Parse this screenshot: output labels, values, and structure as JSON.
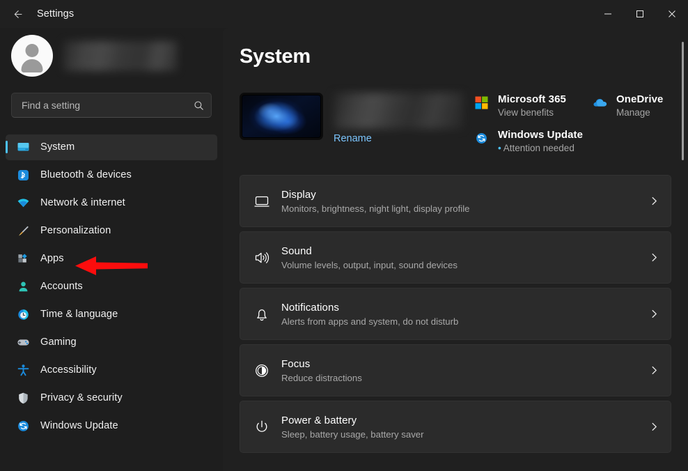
{
  "titlebar": {
    "back_label": "back-arrow",
    "title": "Settings",
    "minimize": "—",
    "maximize": "□",
    "close": "✕"
  },
  "sidebar": {
    "profile": {
      "account_name": ""
    },
    "search": {
      "placeholder": "Find a setting",
      "value": ""
    },
    "items": [
      {
        "label": "System",
        "icon": "monitor-icon",
        "selected": true
      },
      {
        "label": "Bluetooth & devices",
        "icon": "bluetooth-icon",
        "selected": false
      },
      {
        "label": "Network & internet",
        "icon": "wifi-icon",
        "selected": false
      },
      {
        "label": "Personalization",
        "icon": "paintbrush-icon",
        "selected": false
      },
      {
        "label": "Apps",
        "icon": "apps-icon",
        "selected": false
      },
      {
        "label": "Accounts",
        "icon": "person-icon",
        "selected": false
      },
      {
        "label": "Time & language",
        "icon": "clock-globe-icon",
        "selected": false
      },
      {
        "label": "Gaming",
        "icon": "gamepad-icon",
        "selected": false
      },
      {
        "label": "Accessibility",
        "icon": "accessibility-icon",
        "selected": false
      },
      {
        "label": "Privacy & security",
        "icon": "shield-icon",
        "selected": false
      },
      {
        "label": "Windows Update",
        "icon": "sync-icon",
        "selected": false
      }
    ]
  },
  "main": {
    "page_title": "System",
    "device": {
      "thumbnail": "windows-bloom-wallpaper",
      "device_name": "",
      "rename_label": "Rename"
    },
    "services": [
      {
        "title": "Microsoft 365",
        "subtitle": "View benefits",
        "icon": "microsoft-logo-icon",
        "has_dot": false
      },
      {
        "title": "OneDrive",
        "subtitle": "Manage",
        "icon": "onedrive-cloud-icon",
        "has_dot": false
      },
      {
        "title": "Windows Update",
        "subtitle": "Attention needed",
        "icon": "sync-icon",
        "has_dot": true
      }
    ],
    "cards": [
      {
        "title": "Display",
        "subtitle": "Monitors, brightness, night light, display profile",
        "icon": "display-icon"
      },
      {
        "title": "Sound",
        "subtitle": "Volume levels, output, input, sound devices",
        "icon": "sound-icon"
      },
      {
        "title": "Notifications",
        "subtitle": "Alerts from apps and system, do not disturb",
        "icon": "bell-icon"
      },
      {
        "title": "Focus",
        "subtitle": "Reduce distractions",
        "icon": "focus-icon"
      },
      {
        "title": "Power & battery",
        "subtitle": "Sleep, battery usage, battery saver",
        "icon": "power-icon"
      }
    ]
  },
  "annotation": {
    "type": "arrow",
    "points_to": "Apps",
    "color": "#fc0d0d"
  },
  "colors": {
    "accent": "#4cc2ff",
    "sidebar_bg": "#1e1e1e",
    "content_bg": "#202020",
    "card_bg": "#2b2b2b",
    "link": "#7cc6ff",
    "annotation_red": "#fc0d0d"
  }
}
